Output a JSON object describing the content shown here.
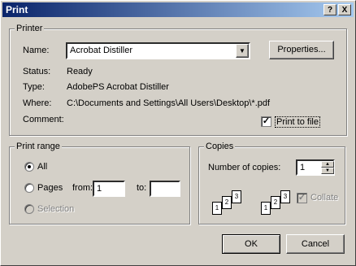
{
  "window": {
    "title": "Print",
    "help_btn": "?",
    "close_btn": "X"
  },
  "printer": {
    "legend": "Printer",
    "name_label": "Name:",
    "name_value": "Acrobat Distiller",
    "properties_label": "Properties...",
    "status_label": "Status:",
    "status_value": "Ready",
    "type_label": "Type:",
    "type_value": "AdobePS Acrobat Distiller",
    "where_label": "Where:",
    "where_value": "C:\\Documents and Settings\\All Users\\Desktop\\*.pdf",
    "comment_label": "Comment:",
    "print_to_file_label": "Print to file",
    "print_to_file_checked": true
  },
  "print_range": {
    "legend": "Print range",
    "all_label": "All",
    "pages_label": "Pages",
    "from_label": "from:",
    "from_value": "1",
    "to_label": "to:",
    "to_value": "",
    "selection_label": "Selection",
    "selected": "all"
  },
  "copies": {
    "legend": "Copies",
    "number_label": "Number of copies:",
    "number_value": "1",
    "collate_label": "Collate",
    "collate_checked": true,
    "collate_enabled": false,
    "page_numbers": [
      "1",
      "2",
      "3"
    ]
  },
  "footer": {
    "ok_label": "OK",
    "cancel_label": "Cancel"
  }
}
